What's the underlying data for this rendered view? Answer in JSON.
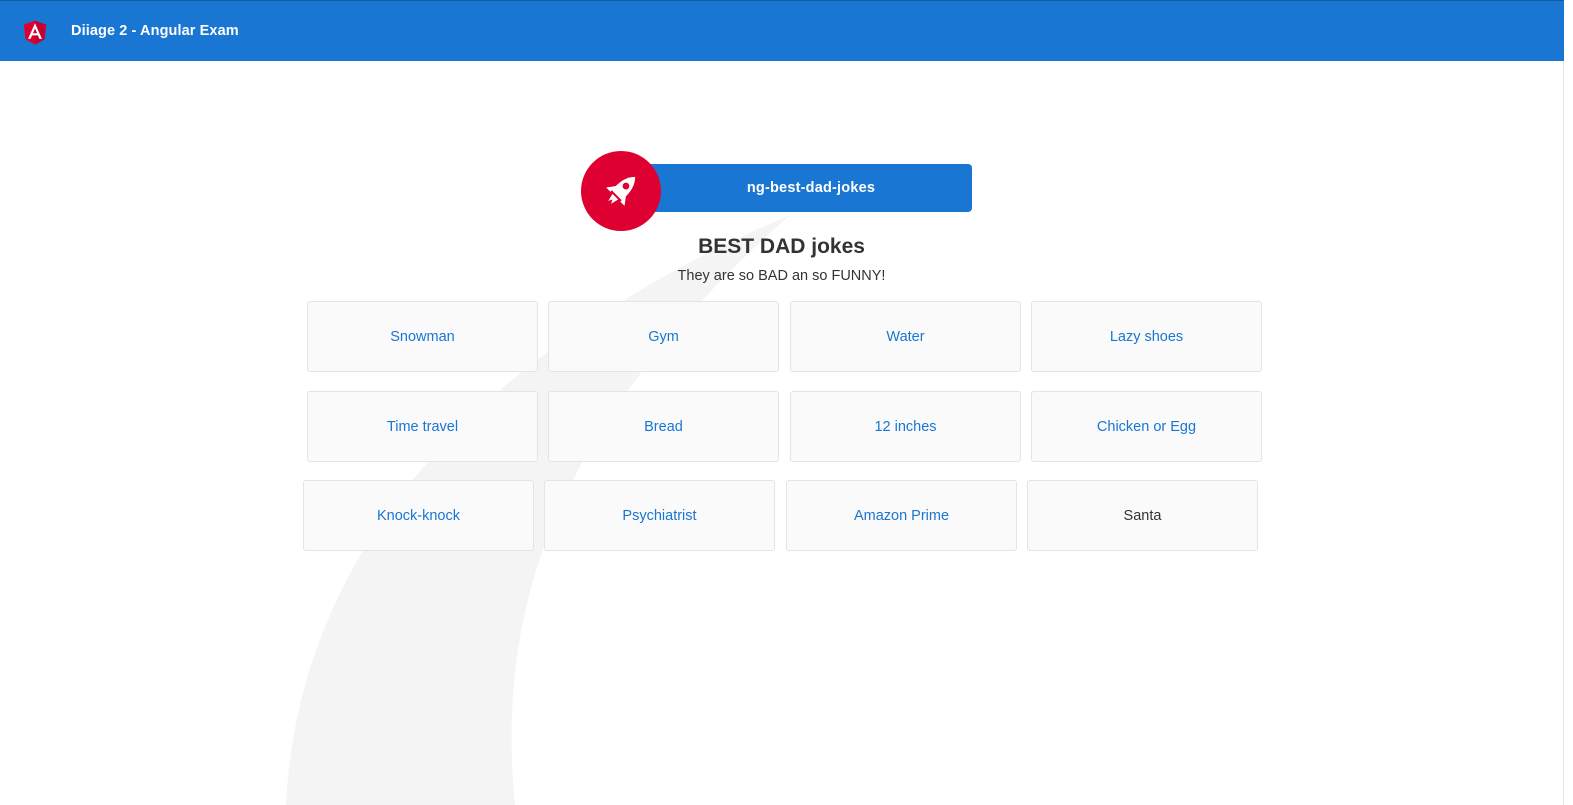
{
  "toolbar": {
    "title": "Diiage 2 - Angular Exam",
    "logo_icon": "angular-logo-icon",
    "background": "#1976d2"
  },
  "banner": {
    "label": "ng-best-dad-jokes",
    "icon": "rocket-icon",
    "icon_background": "#dd0031"
  },
  "main": {
    "heading": "BEST DAD jokes",
    "subheading": "They are so BAD an so FUNNY!"
  },
  "jokes": [
    {
      "label": "Snowman"
    },
    {
      "label": "Gym"
    },
    {
      "label": "Water"
    },
    {
      "label": "Lazy shoes"
    },
    {
      "label": "Time travel"
    },
    {
      "label": "Bread"
    },
    {
      "label": "12 inches"
    },
    {
      "label": "Chicken or Egg"
    },
    {
      "label": "Knock-knock"
    },
    {
      "label": "Psychiatrist"
    },
    {
      "label": "Amazon Prime"
    },
    {
      "label": "Santa"
    }
  ],
  "colors": {
    "accent": "#1976d2",
    "brand_red": "#dd0031",
    "card_background": "#fafafa",
    "text": "#333333"
  }
}
